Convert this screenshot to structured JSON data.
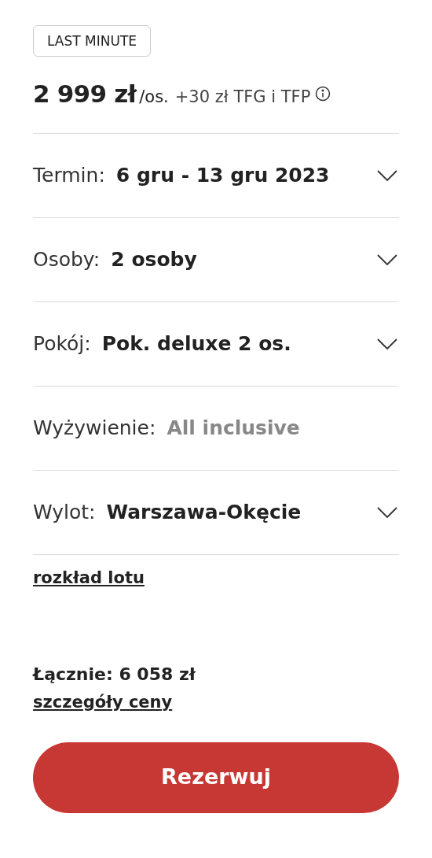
{
  "badge": "LAST MINUTE",
  "price": {
    "amount": "2 999 zł",
    "per": "/os.",
    "extra": "+30 zł TFG i TFP"
  },
  "options": [
    {
      "kind": "select",
      "label": "Termin:",
      "value": "6 gru - 13 gru 2023"
    },
    {
      "kind": "select",
      "label": "Osoby:",
      "value": "2 osoby"
    },
    {
      "kind": "select",
      "label": "Pokój:",
      "value": "Pok. deluxe 2 os."
    },
    {
      "kind": "static",
      "label": "Wyżywienie:",
      "value": "All inclusive"
    },
    {
      "kind": "select",
      "label": "Wylot:",
      "value": "Warszawa-Okęcie"
    }
  ],
  "flight_link": "rozkład lotu",
  "total": "Łącznie: 6 058 zł",
  "price_details_link": "szczegóły ceny",
  "book_button": "Rezerwuj"
}
